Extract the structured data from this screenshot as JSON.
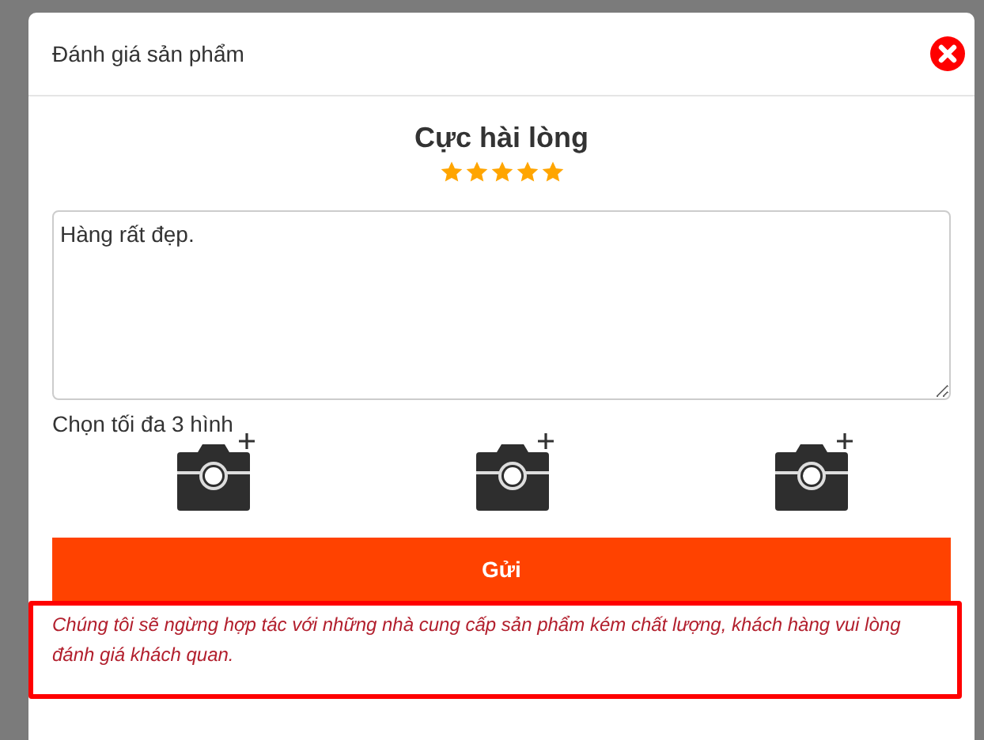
{
  "dialog": {
    "title": "Đánh giá sản phẩm"
  },
  "rating": {
    "label": "Cực hài lòng",
    "stars": 5
  },
  "review": {
    "value": "Hàng rất đẹp."
  },
  "photos": {
    "label": "Chọn tối đa 3 hình",
    "slots": [
      {
        "kind": "add-photo"
      },
      {
        "kind": "add-photo"
      },
      {
        "kind": "add-photo"
      }
    ]
  },
  "submit_button": "Gửi",
  "notice": "Chúng tôi sẽ ngừng hợp tác với những nhà cung cấp sản phẩm kém chất lượng, khách hàng vui lòng đánh giá khách quan."
}
